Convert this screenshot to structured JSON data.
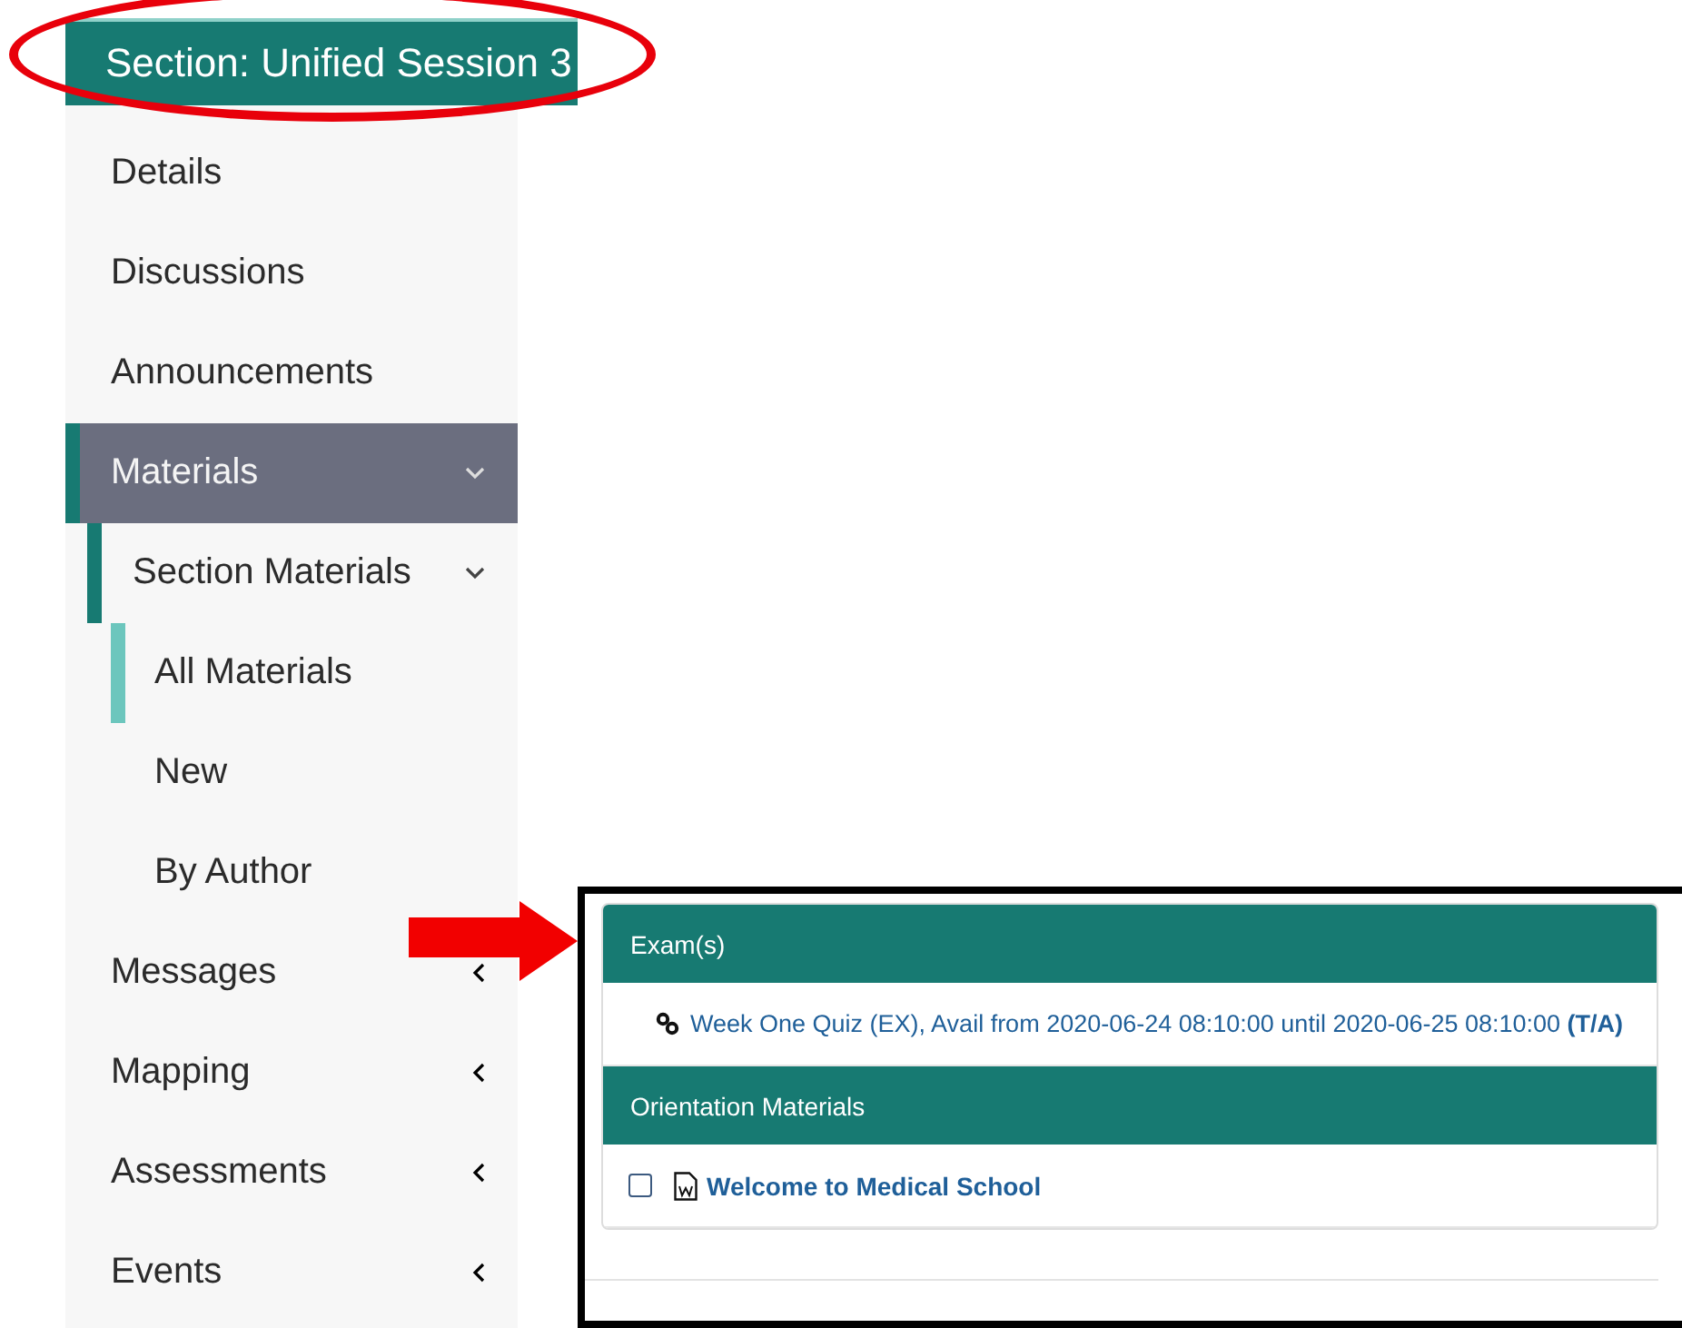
{
  "section_header": {
    "title": "Section: Unified Session 3"
  },
  "sidebar": {
    "items": [
      {
        "label": "Details",
        "kind": "link",
        "selected": false
      },
      {
        "label": "Discussions",
        "kind": "link",
        "selected": false
      },
      {
        "label": "Announcements",
        "kind": "link",
        "selected": false
      },
      {
        "label": "Materials",
        "kind": "group",
        "selected": true,
        "expanded": true,
        "children": [
          {
            "label": "Section Materials",
            "kind": "group",
            "selected": true,
            "expanded": true,
            "children": [
              {
                "label": "All Materials",
                "kind": "link",
                "selected": true
              },
              {
                "label": "New",
                "kind": "link",
                "selected": false
              },
              {
                "label": "By Author",
                "kind": "link",
                "selected": false
              }
            ]
          }
        ]
      },
      {
        "label": "Messages",
        "kind": "group",
        "selected": false,
        "expanded": false
      },
      {
        "label": "Mapping",
        "kind": "group",
        "selected": false,
        "expanded": false
      },
      {
        "label": "Assessments",
        "kind": "group",
        "selected": false,
        "expanded": false
      },
      {
        "label": "Events",
        "kind": "group",
        "selected": false,
        "expanded": false
      }
    ]
  },
  "materials": {
    "sections": [
      {
        "title": "Exam(s)",
        "items": [
          {
            "kind": "link",
            "text": "Week One Quiz (EX), Avail from 2020-06-24 08:10:00 until 2020-06-25 08:10:00 **(T/A)**"
          }
        ]
      },
      {
        "title": "Orientation Materials",
        "items": [
          {
            "kind": "document",
            "text": "Welcome to Medical School",
            "checked": false
          }
        ]
      }
    ]
  }
}
